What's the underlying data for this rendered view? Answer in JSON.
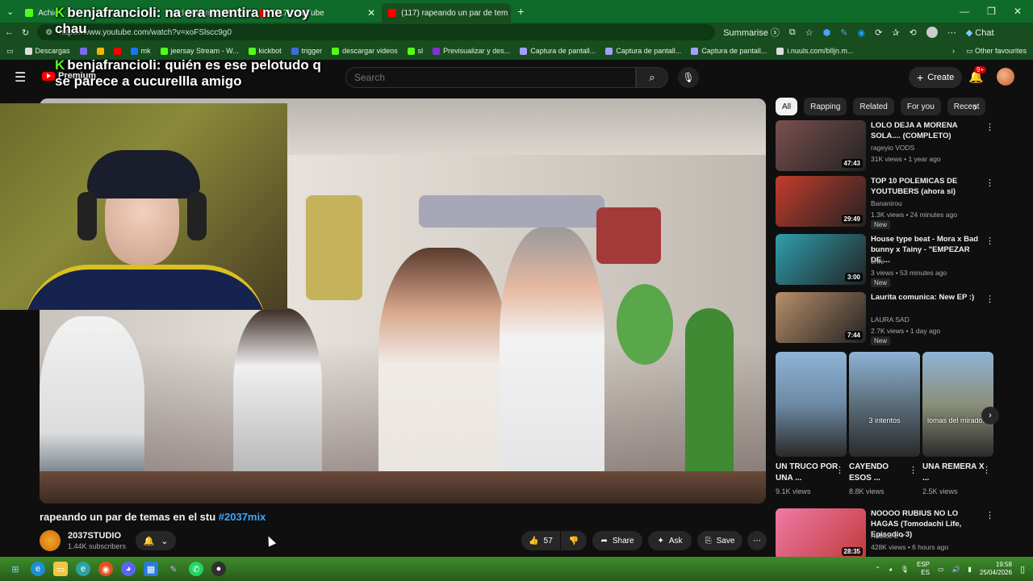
{
  "browser": {
    "tabs": [
      {
        "label": "Achie",
        "favicon_color": "#53fc18",
        "active": false
      },
      {
        "label": "oud Streaming Bot fo",
        "favicon_color": "#4a90e2",
        "active": false
      },
      {
        "label": "(117) YouTube",
        "favicon_color": "#ff0000",
        "active": false
      },
      {
        "label": "(117) rapeando un par de tem",
        "favicon_color": "#ff0000",
        "active": true
      }
    ],
    "new_tab": "+",
    "url": "https://www.youtube.com/watch?v=xoFSlscc9g0",
    "summarise_label": "Summarise",
    "chat_label": "Chat",
    "bookmarks": [
      {
        "label": "Descargas",
        "color": "#dddddd"
      },
      {
        "label": "",
        "color": "#7b68ee"
      },
      {
        "label": "",
        "color": "#f4b400"
      },
      {
        "label": "",
        "color": "#ff0000"
      },
      {
        "label": "mk",
        "color": "#1877f2"
      },
      {
        "label": "jeersay Stream - W...",
        "color": "#53fc18"
      },
      {
        "label": "kickbot",
        "color": "#53fc18"
      },
      {
        "label": "trigger",
        "color": "#4169e1"
      },
      {
        "label": "descargar videos",
        "color": "#53fc18"
      },
      {
        "label": "sl",
        "color": "#53fc18"
      },
      {
        "label": "Previsualizar y des...",
        "color": "#8a2be2"
      },
      {
        "label": "Captura de pantall...",
        "color": "#a0a0ff"
      },
      {
        "label": "Captura de pantall...",
        "color": "#a0a0ff"
      },
      {
        "label": "Captura de pantall...",
        "color": "#a0a0ff"
      },
      {
        "label": "i.nuuls.com/bIljn.m...",
        "color": "#dddddd"
      }
    ],
    "other_favourites": "Other favourites"
  },
  "chat_overlay": [
    {
      "user": "benjafrancioli:",
      "line1": "na era mentira me voy",
      "line2": "chau"
    },
    {
      "user": "benjafrancioli:",
      "line1": "quién es ese pelotudo q",
      "line2": "se parece a cucurellla amigo"
    }
  ],
  "youtube": {
    "premium_label": "Premium",
    "search_placeholder": "Search",
    "create_label": "Create",
    "notif_badge": "9+",
    "video": {
      "title_text": "rapeando un par de temas en el stu ",
      "hashtag": "#2037mix",
      "channel": "2037STUDIO",
      "subscribers": "1.44K subscribers",
      "likes": "57",
      "share": "Share",
      "ask": "Ask",
      "save": "Save"
    },
    "chips": [
      "All",
      "Rapping",
      "Related",
      "For you",
      "Recent"
    ],
    "recommendations": [
      {
        "title": "LOLO DEJA A MORENA SOLA.... (COMPLETO)",
        "channel": "rageyio VODS",
        "meta": "31K views • 1 year ago",
        "duration": "47:43",
        "new": "",
        "thumb": "#7a4f4f"
      },
      {
        "title": "TOP 10 POLEMICAS DE YOUTUBERS (ahora si)",
        "channel": "Bananirou",
        "meta": "1.3K views • 24 minutes ago",
        "duration": "29:49",
        "new": "New",
        "thumb": "#c43c2c"
      },
      {
        "title": "House type beat - Mora x Bad bunny x Tainy - \"EMPEZAR DE ...",
        "channel": "enni",
        "meta": "3 views • 53 minutes ago",
        "duration": "3:00",
        "new": "New",
        "thumb": "#2f9fae"
      },
      {
        "title": "Laurita comunica: New EP :)",
        "channel": "LAURA SAD",
        "meta": "2.7K views • 1 day ago",
        "duration": "7:44",
        "new": "New",
        "thumb": "#b88f6a"
      }
    ],
    "shorts": [
      {
        "title": "UN TRUCO POR UNA ...",
        "views": "9.1K views",
        "overlay": "",
        "thumb": "#6d8aa5"
      },
      {
        "title": "CAYENDO ESOS ...",
        "views": "8.8K views",
        "overlay": "3 intentos",
        "thumb": "#5a6d7a"
      },
      {
        "title": "UNA REMERA X ...",
        "views": "2.5K views",
        "overlay": "lomas del mirado...",
        "thumb": "#8a8f7a"
      }
    ],
    "last_rec": {
      "title": "NOOOO RUBIUS NO LO HAGAS (Tomodachi Life, Episodio 3)",
      "channel": "Rubius Z",
      "meta": "428K views • 6 hours ago",
      "duration": "28:35",
      "thumb": "#f07aa8"
    }
  },
  "taskbar": {
    "lang_top": "ESP",
    "lang_bottom": "ES",
    "time": "19:58",
    "date": "25/04/2026"
  }
}
